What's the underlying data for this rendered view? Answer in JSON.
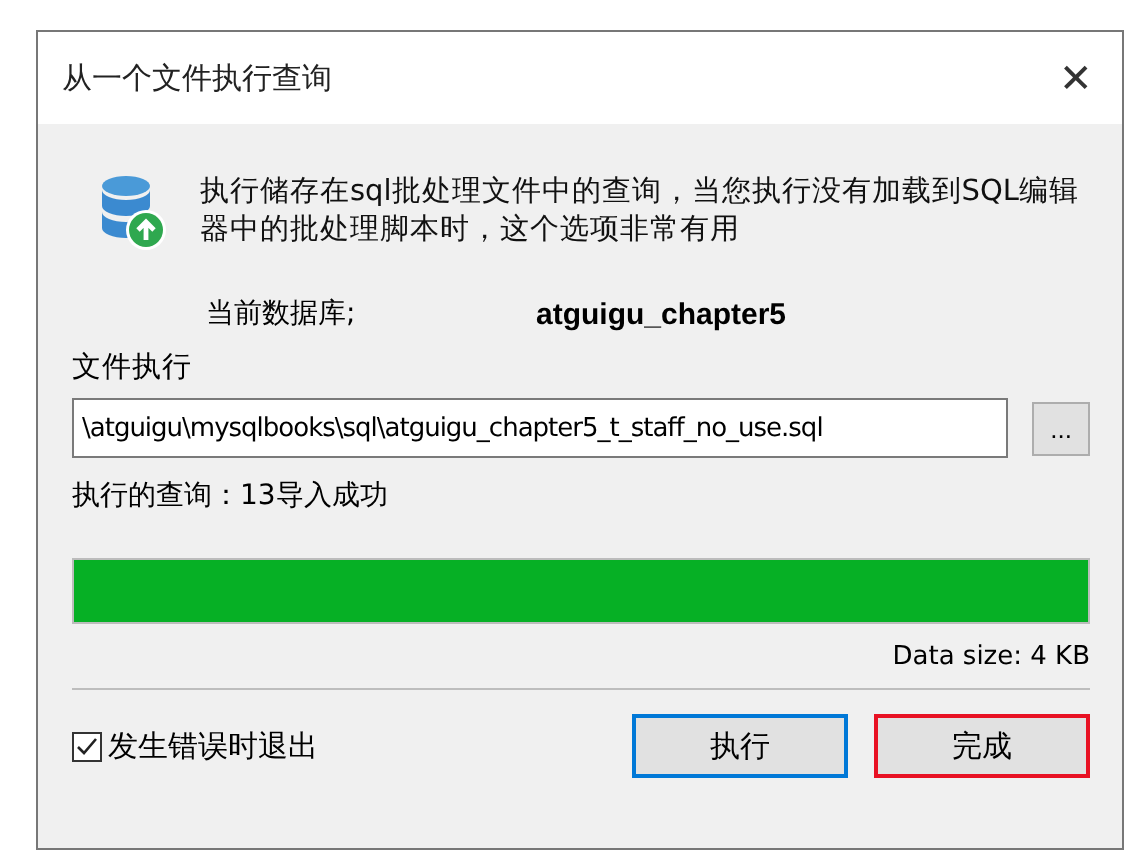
{
  "window": {
    "title": "从一个文件执行查询",
    "close": "✕"
  },
  "description": "执行储存在sql批处理文件中的查询，当您执行没有加载到SQL编辑器中的批处理脚本时，这个选项非常有用",
  "database": {
    "label": "当前数据库;",
    "value": "atguigu_chapter5"
  },
  "file": {
    "label": "文件执行",
    "value": "\\atguigu\\mysqlbooks\\sql\\atguigu_chapter5_t_staff_no_use.sql",
    "browse": "..."
  },
  "status": "执行的查询：13导入成功",
  "progress": {
    "level": 1
  },
  "data_size": "Data size: 4 KB",
  "exit_on_error": {
    "label": "发生错误时退出",
    "checked": true
  },
  "buttons": [
    {
      "label": "执行",
      "color": "#0078d7"
    },
    {
      "label": "完成",
      "color": "#e81123"
    }
  ]
}
